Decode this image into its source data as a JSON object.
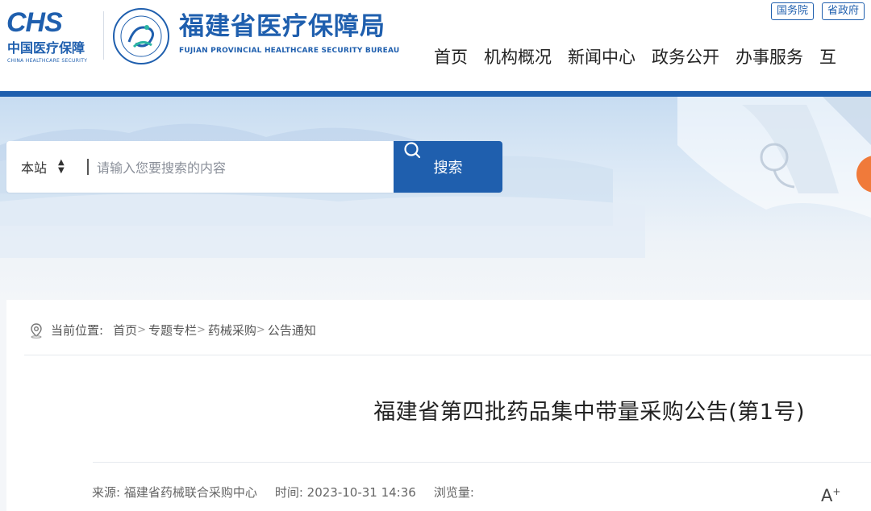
{
  "header": {
    "chs_mark": "CHS",
    "chs_cn": "中国医疗保障",
    "chs_en": "CHINA HEALTHCARE SECURITY",
    "bureau_cn": "福建省医疗保障局",
    "bureau_en": "FUJIAN PROVINCIAL HEALTHCARE SECURITY BUREAU",
    "top_links": [
      "国务院",
      "省政府"
    ],
    "nav": [
      "首页",
      "机构概况",
      "新闻中心",
      "政务公开",
      "办事服务",
      "互"
    ]
  },
  "search": {
    "scope": "本站",
    "placeholder": "请输入您要搜索的内容",
    "button_label": "搜索"
  },
  "breadcrumb": {
    "label": "当前位置:",
    "items": [
      "首页",
      "专题专栏",
      "药械采购",
      "公告通知"
    ],
    "separator": ">"
  },
  "article": {
    "title": "福建省第四批药品集中带量采购公告(第1号)",
    "source": "来源: 福建省药械联合采购中心",
    "time": "时间: 2023-10-31 14:36",
    "views": "浏览量:",
    "font_increase": "A"
  },
  "colors": {
    "brand": "#1f5fae",
    "accent_orange": "#f07a3a"
  }
}
